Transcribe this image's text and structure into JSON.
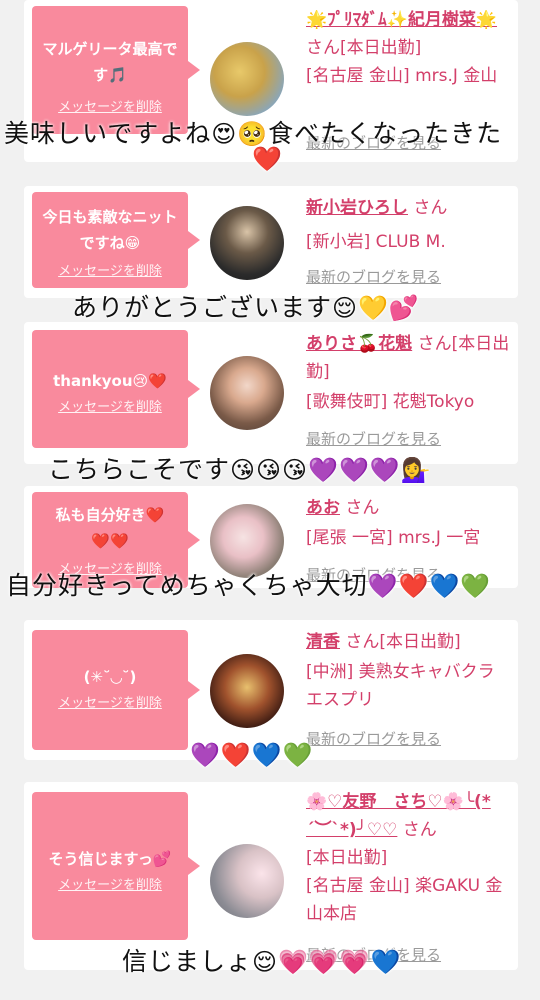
{
  "cards": [
    {
      "message": "マルゲリータ最高です🎵",
      "delete_label": "メッセージを削除",
      "name": "🌟ﾌﾟﾘﾏﾀﾞﾑ✨紀月樹菜🌟",
      "suffix": "さん[本日出勤]",
      "location": "[名古屋 金山] mrs.J 金山",
      "blog_label": "最新のブログを見る"
    },
    {
      "message": "今日も素敵なニットですね😁",
      "delete_label": "メッセージを削除",
      "name": "新小岩ひろし",
      "suffix": "さん",
      "location": "[新小岩] CLUB M.",
      "blog_label": "最新のブログを見る"
    },
    {
      "message": "thankyou😢❤️",
      "delete_label": "メッセージを削除",
      "name": "ありさ🍒花魁",
      "suffix": "さん[本日出勤]",
      "location": "[歌舞伎町] 花魁Tokyo",
      "blog_label": "最新のブログを見る"
    },
    {
      "message": "私も自分好き❤️❤️❤️",
      "delete_label": "メッセージを削除",
      "name": "あお",
      "suffix": "さん",
      "location": "[尾張 一宮] mrs.J 一宮",
      "blog_label": "最新のブログを見る"
    },
    {
      "message": "(✳︎˘◡˘)",
      "delete_label": "メッセージを削除",
      "name": "清香",
      "suffix": "さん[本日出勤]",
      "location": "[中洲] 美熟女キャバクラ エスプリ",
      "blog_label": "最新のブログを見る"
    },
    {
      "message": "そう信じますっ💕",
      "delete_label": "メッセージを削除",
      "name": "🌸♡友野　さち♡🌸╰(*´︶`*)╯♡♡",
      "suffix": "さん",
      "location": "[本日出勤]",
      "location2": "[名古屋 金山] 楽GAKU 金山本店",
      "blog_label": "最新のブログを見る"
    }
  ],
  "overlays": [
    {
      "text": "美味しいですよね",
      "emoji": "😍🥺",
      "text2": "食べたくなったきた",
      "emoji2": "❤️"
    },
    {
      "text": "ありがとうございます",
      "emoji": "😌💛💕"
    },
    {
      "text": "こちらこそです",
      "emoji": "😘😘😘💜💜💜💁‍♀️"
    },
    {
      "text": "自分好きってめちゃくちゃ大切",
      "emoji": "💜❤️💙💚"
    },
    {
      "text": "",
      "emoji": "💜❤️💙💚"
    },
    {
      "text": "信じましょ",
      "emoji": "😌💗💗💗💙"
    }
  ]
}
